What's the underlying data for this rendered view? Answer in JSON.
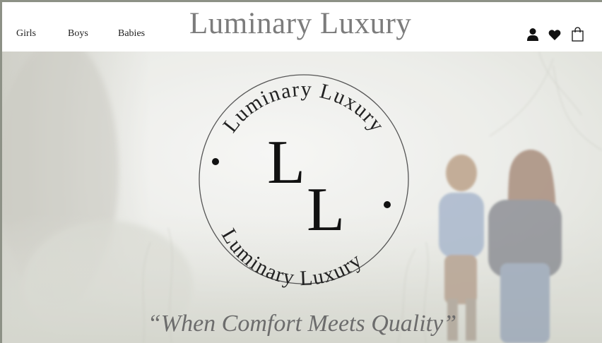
{
  "header": {
    "nav": [
      {
        "label": "Girls"
      },
      {
        "label": "Boys"
      },
      {
        "label": "Babies"
      }
    ],
    "brand": "Luminary Luxury",
    "icons": [
      "user-icon",
      "heart-icon",
      "shopping-bag-icon"
    ]
  },
  "hero": {
    "logo": {
      "arc_top": "Luminary Luxury",
      "arc_bottom": "Luminary Luxury",
      "monogram_1": "L",
      "monogram_2": "L"
    },
    "tagline": "“When Comfort Meets Quality”"
  },
  "colors": {
    "brand_text": "#7c7c7c",
    "tagline_text": "#6c6c6c",
    "icon": "#111111",
    "page_frame": "#8d9186"
  }
}
